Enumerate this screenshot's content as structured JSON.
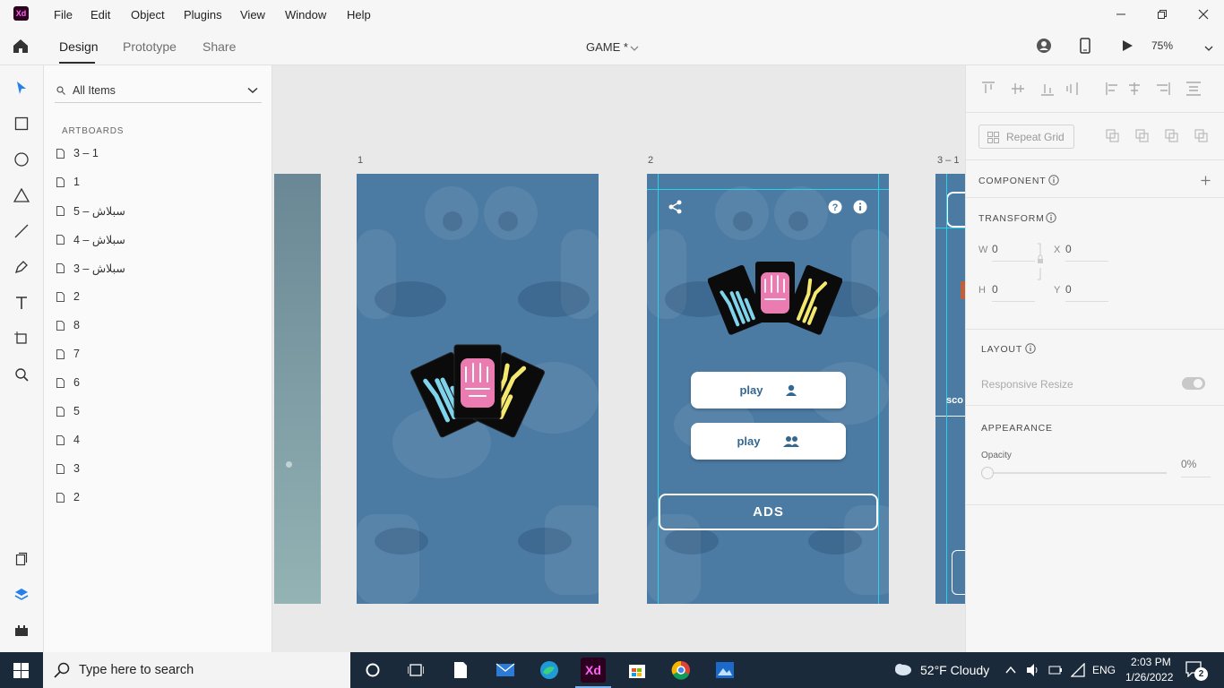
{
  "app": {
    "logo": "Xd"
  },
  "menu": [
    "File",
    "Edit",
    "Object",
    "Plugins",
    "View",
    "Window",
    "Help"
  ],
  "tabs": {
    "design": "Design",
    "prototype": "Prototype",
    "share": "Share"
  },
  "document_title": "GAME *",
  "zoom": "75%",
  "layers": {
    "filter": "All Items",
    "section": "ARTBOARDS",
    "items": [
      "3 – 1",
      "1",
      "سبلاش – 5",
      "سبلاش – 4",
      "سبلاش – 3",
      "2",
      "8",
      "7",
      "6",
      "5",
      "4",
      "3",
      "2"
    ]
  },
  "canvas": {
    "labels": {
      "a1": "1",
      "a2": "2",
      "a3": "3 – 1"
    },
    "artboard2": {
      "play_single": "play",
      "play_multi": "play",
      "ads": "ADS"
    },
    "partial_text": "sco"
  },
  "props": {
    "repeat_grid": "Repeat Grid",
    "component": "COMPONENT",
    "transform": "TRANSFORM",
    "w_label": "W",
    "w_val": "0",
    "x_label": "X",
    "x_val": "0",
    "h_label": "H",
    "h_val": "0",
    "y_label": "Y",
    "y_val": "0",
    "layout": "LAYOUT",
    "responsive": "Responsive Resize",
    "appearance": "APPEARANCE",
    "opacity_label": "Opacity",
    "opacity_val": "0%"
  },
  "taskbar": {
    "search_placeholder": "Type here to search",
    "weather": "52°F  Cloudy",
    "lang": "ENG",
    "time": "2:03 PM",
    "date": "1/26/2022",
    "notifications": "2"
  },
  "colors": {
    "artboard": "#4b7aa3",
    "accent": "#2aa7c9",
    "taskbar": "#1b2a3a",
    "xd_pink": "#ff61f6"
  }
}
